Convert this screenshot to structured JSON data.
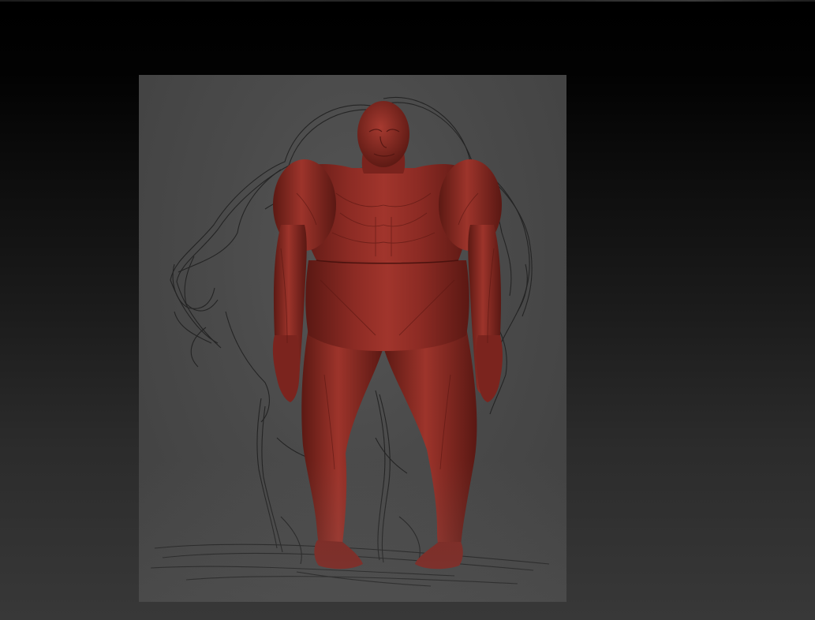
{
  "viewport": {
    "background_top": "#000000",
    "background_bottom": "#383838"
  },
  "document": {
    "background": "#4c4c4c",
    "sketch_color": "#1d1d1d",
    "model_color": "#8a2a24",
    "model_highlight": "#b0443a",
    "model_shadow": "#4e1410"
  }
}
